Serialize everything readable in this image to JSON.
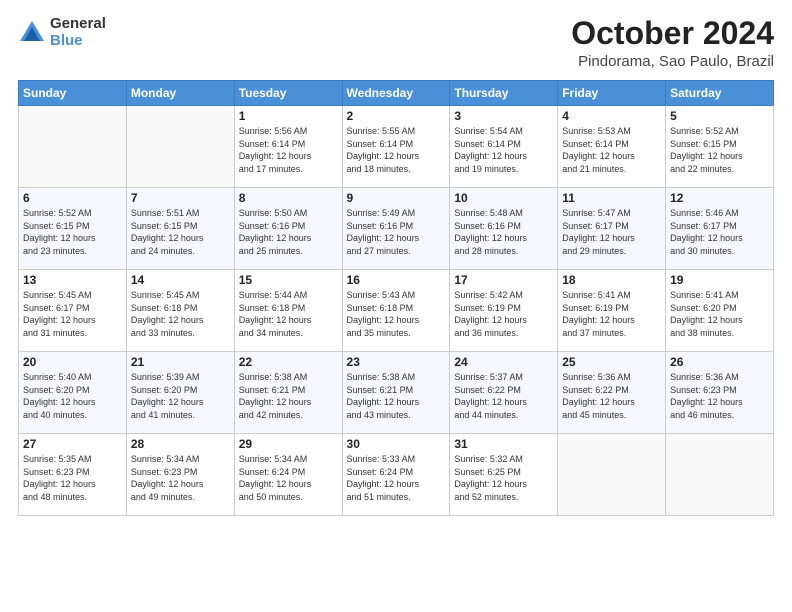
{
  "logo": {
    "general": "General",
    "blue": "Blue"
  },
  "header": {
    "month_year": "October 2024",
    "location": "Pindorama, Sao Paulo, Brazil"
  },
  "weekdays": [
    "Sunday",
    "Monday",
    "Tuesday",
    "Wednesday",
    "Thursday",
    "Friday",
    "Saturday"
  ],
  "weeks": [
    [
      {
        "day": "",
        "info": ""
      },
      {
        "day": "",
        "info": ""
      },
      {
        "day": "1",
        "info": "Sunrise: 5:56 AM\nSunset: 6:14 PM\nDaylight: 12 hours\nand 17 minutes."
      },
      {
        "day": "2",
        "info": "Sunrise: 5:55 AM\nSunset: 6:14 PM\nDaylight: 12 hours\nand 18 minutes."
      },
      {
        "day": "3",
        "info": "Sunrise: 5:54 AM\nSunset: 6:14 PM\nDaylight: 12 hours\nand 19 minutes."
      },
      {
        "day": "4",
        "info": "Sunrise: 5:53 AM\nSunset: 6:14 PM\nDaylight: 12 hours\nand 21 minutes."
      },
      {
        "day": "5",
        "info": "Sunrise: 5:52 AM\nSunset: 6:15 PM\nDaylight: 12 hours\nand 22 minutes."
      }
    ],
    [
      {
        "day": "6",
        "info": "Sunrise: 5:52 AM\nSunset: 6:15 PM\nDaylight: 12 hours\nand 23 minutes."
      },
      {
        "day": "7",
        "info": "Sunrise: 5:51 AM\nSunset: 6:15 PM\nDaylight: 12 hours\nand 24 minutes."
      },
      {
        "day": "8",
        "info": "Sunrise: 5:50 AM\nSunset: 6:16 PM\nDaylight: 12 hours\nand 25 minutes."
      },
      {
        "day": "9",
        "info": "Sunrise: 5:49 AM\nSunset: 6:16 PM\nDaylight: 12 hours\nand 27 minutes."
      },
      {
        "day": "10",
        "info": "Sunrise: 5:48 AM\nSunset: 6:16 PM\nDaylight: 12 hours\nand 28 minutes."
      },
      {
        "day": "11",
        "info": "Sunrise: 5:47 AM\nSunset: 6:17 PM\nDaylight: 12 hours\nand 29 minutes."
      },
      {
        "day": "12",
        "info": "Sunrise: 5:46 AM\nSunset: 6:17 PM\nDaylight: 12 hours\nand 30 minutes."
      }
    ],
    [
      {
        "day": "13",
        "info": "Sunrise: 5:45 AM\nSunset: 6:17 PM\nDaylight: 12 hours\nand 31 minutes."
      },
      {
        "day": "14",
        "info": "Sunrise: 5:45 AM\nSunset: 6:18 PM\nDaylight: 12 hours\nand 33 minutes."
      },
      {
        "day": "15",
        "info": "Sunrise: 5:44 AM\nSunset: 6:18 PM\nDaylight: 12 hours\nand 34 minutes."
      },
      {
        "day": "16",
        "info": "Sunrise: 5:43 AM\nSunset: 6:18 PM\nDaylight: 12 hours\nand 35 minutes."
      },
      {
        "day": "17",
        "info": "Sunrise: 5:42 AM\nSunset: 6:19 PM\nDaylight: 12 hours\nand 36 minutes."
      },
      {
        "day": "18",
        "info": "Sunrise: 5:41 AM\nSunset: 6:19 PM\nDaylight: 12 hours\nand 37 minutes."
      },
      {
        "day": "19",
        "info": "Sunrise: 5:41 AM\nSunset: 6:20 PM\nDaylight: 12 hours\nand 38 minutes."
      }
    ],
    [
      {
        "day": "20",
        "info": "Sunrise: 5:40 AM\nSunset: 6:20 PM\nDaylight: 12 hours\nand 40 minutes."
      },
      {
        "day": "21",
        "info": "Sunrise: 5:39 AM\nSunset: 6:20 PM\nDaylight: 12 hours\nand 41 minutes."
      },
      {
        "day": "22",
        "info": "Sunrise: 5:38 AM\nSunset: 6:21 PM\nDaylight: 12 hours\nand 42 minutes."
      },
      {
        "day": "23",
        "info": "Sunrise: 5:38 AM\nSunset: 6:21 PM\nDaylight: 12 hours\nand 43 minutes."
      },
      {
        "day": "24",
        "info": "Sunrise: 5:37 AM\nSunset: 6:22 PM\nDaylight: 12 hours\nand 44 minutes."
      },
      {
        "day": "25",
        "info": "Sunrise: 5:36 AM\nSunset: 6:22 PM\nDaylight: 12 hours\nand 45 minutes."
      },
      {
        "day": "26",
        "info": "Sunrise: 5:36 AM\nSunset: 6:23 PM\nDaylight: 12 hours\nand 46 minutes."
      }
    ],
    [
      {
        "day": "27",
        "info": "Sunrise: 5:35 AM\nSunset: 6:23 PM\nDaylight: 12 hours\nand 48 minutes."
      },
      {
        "day": "28",
        "info": "Sunrise: 5:34 AM\nSunset: 6:23 PM\nDaylight: 12 hours\nand 49 minutes."
      },
      {
        "day": "29",
        "info": "Sunrise: 5:34 AM\nSunset: 6:24 PM\nDaylight: 12 hours\nand 50 minutes."
      },
      {
        "day": "30",
        "info": "Sunrise: 5:33 AM\nSunset: 6:24 PM\nDaylight: 12 hours\nand 51 minutes."
      },
      {
        "day": "31",
        "info": "Sunrise: 5:32 AM\nSunset: 6:25 PM\nDaylight: 12 hours\nand 52 minutes."
      },
      {
        "day": "",
        "info": ""
      },
      {
        "day": "",
        "info": ""
      }
    ]
  ]
}
